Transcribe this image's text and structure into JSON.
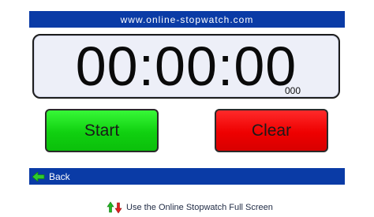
{
  "header": {
    "title": "www.online-stopwatch.com"
  },
  "stopwatch": {
    "time": "00:00:00",
    "milliseconds": "000"
  },
  "buttons": {
    "start_label": "Start",
    "clear_label": "Clear"
  },
  "nav": {
    "back_label": "Back",
    "back_icon": "arrow-left-icon"
  },
  "footer": {
    "fullscreen_label": "Use the Online Stopwatch Full Screen",
    "fullscreen_icon": "fullscreen-arrows-icon"
  },
  "colors": {
    "bar": "#0a3ba6",
    "start": "#10d010",
    "clear": "#ee0000",
    "display_bg": "#edeff8"
  }
}
